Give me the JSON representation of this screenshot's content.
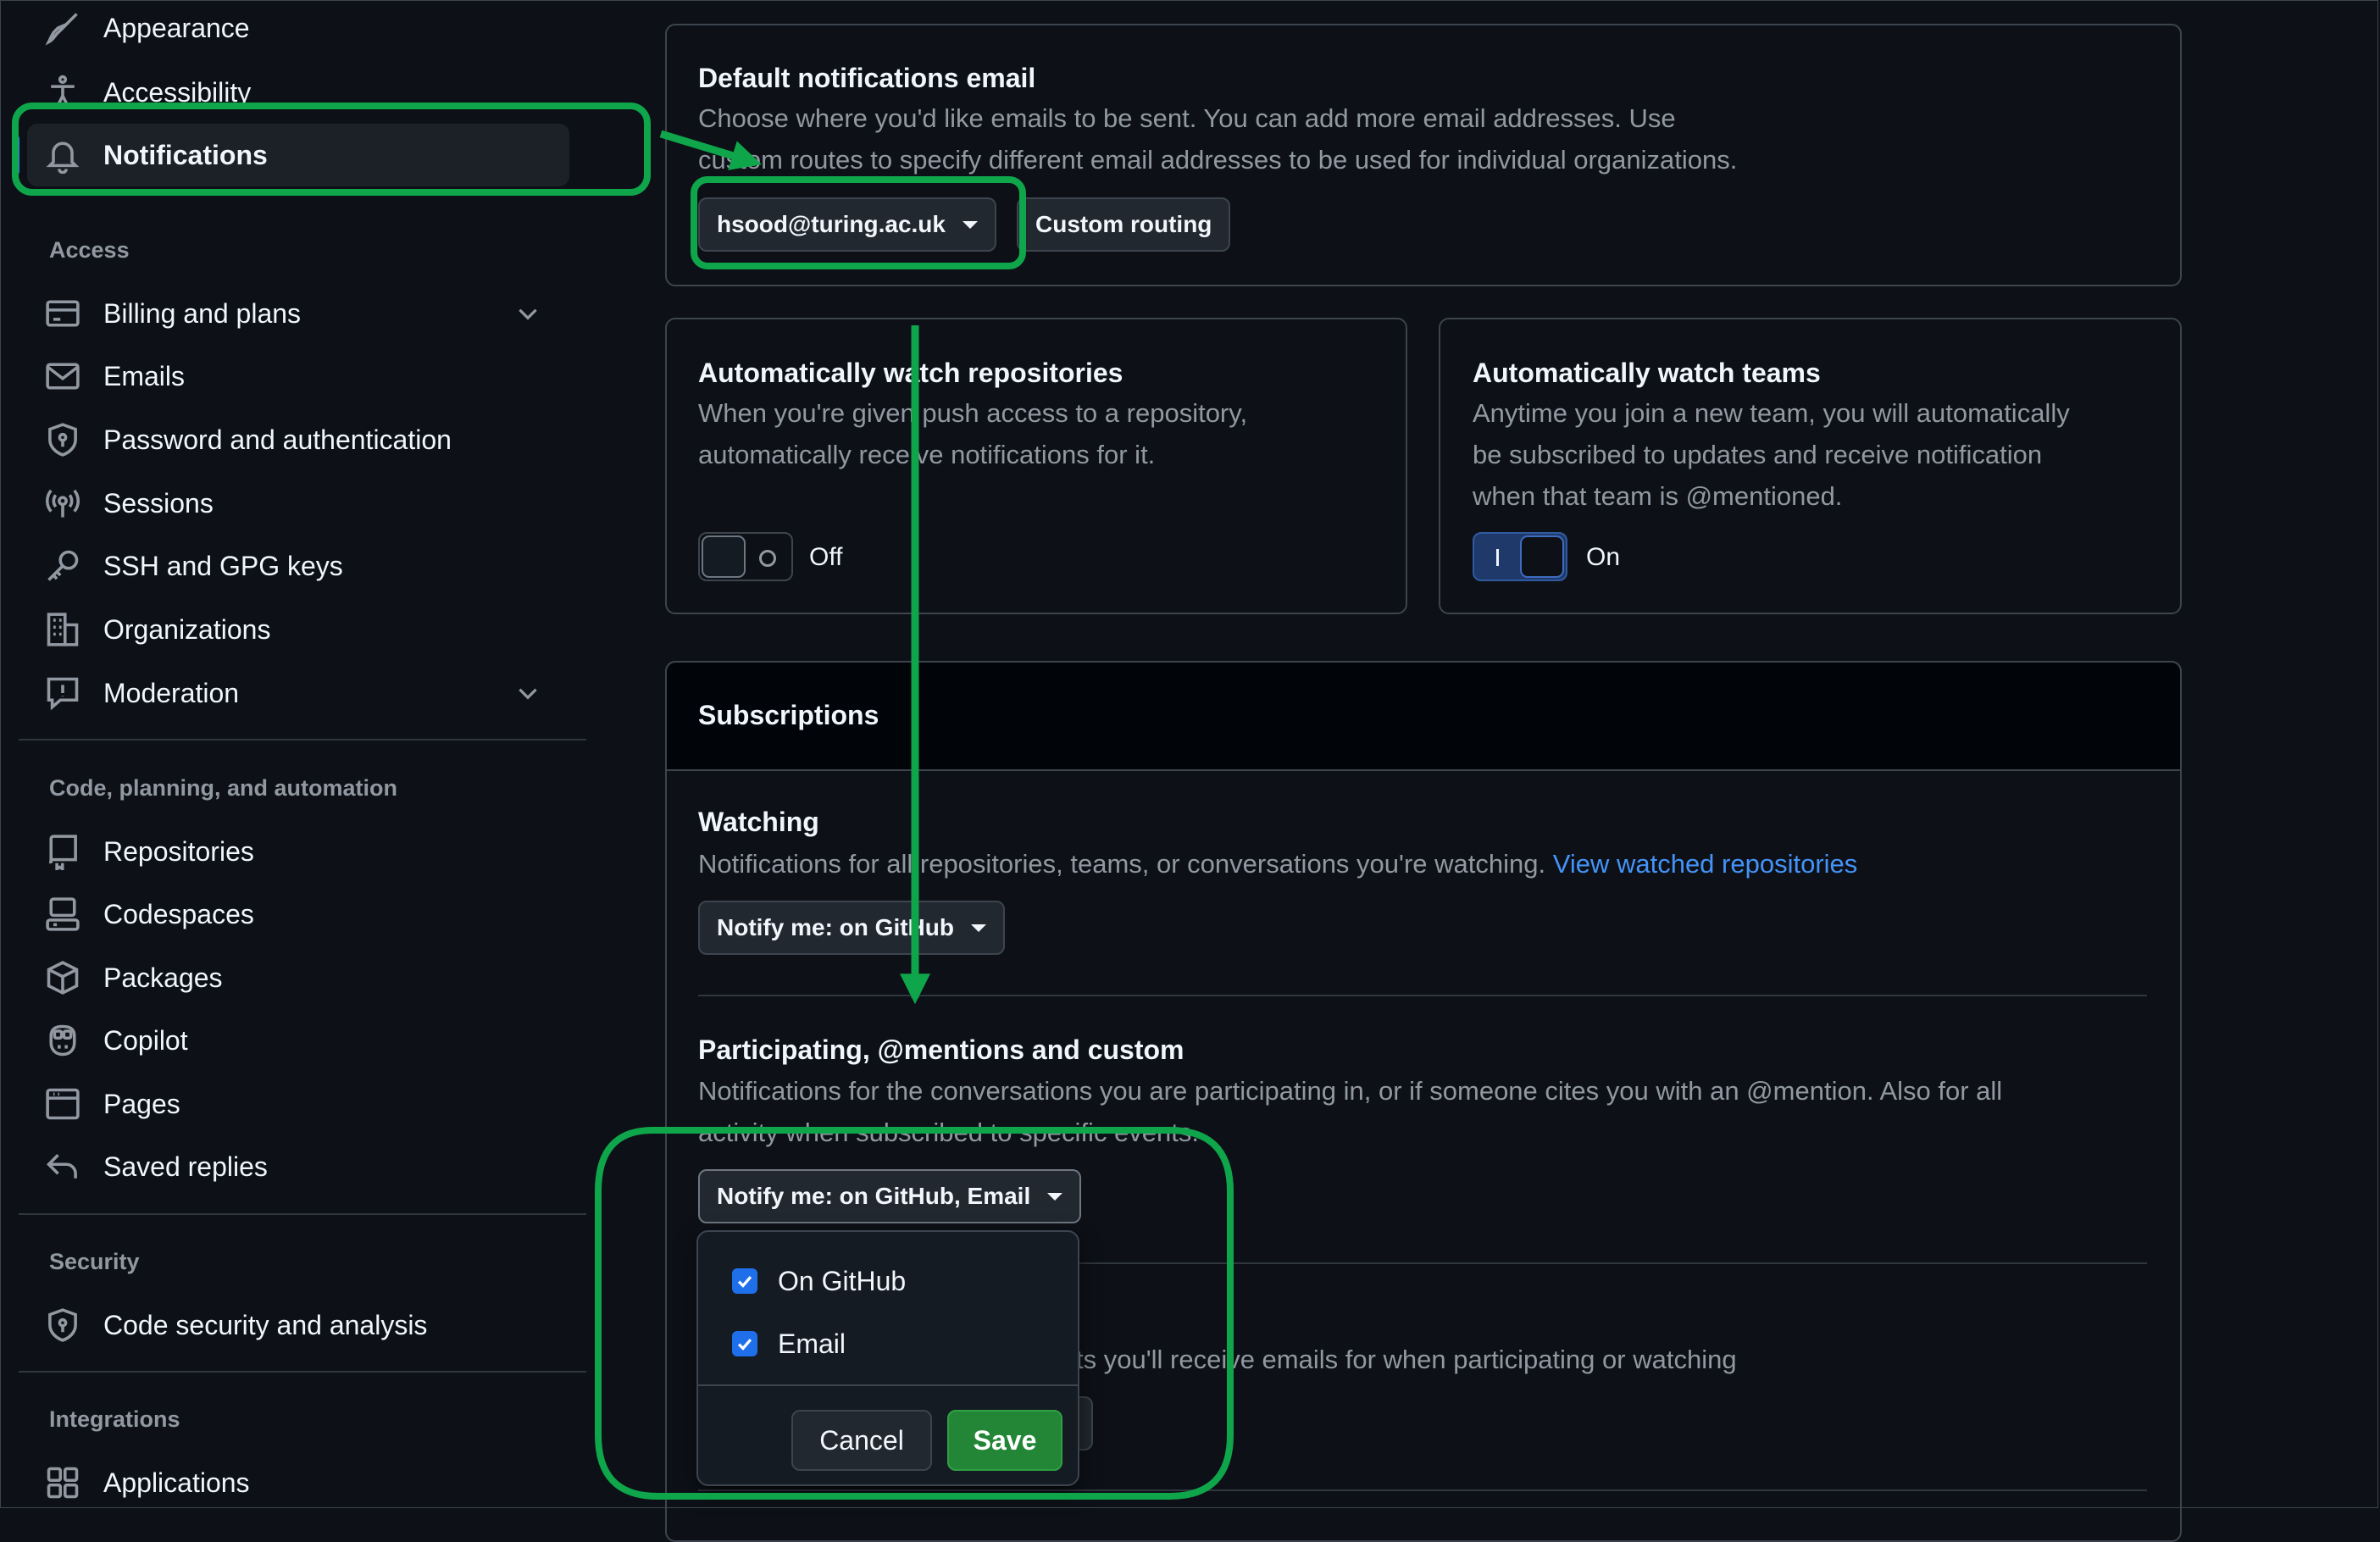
{
  "sidebar": {
    "items": [
      {
        "label": "Appearance"
      },
      {
        "label": "Accessibility"
      },
      {
        "label": "Notifications"
      },
      {
        "label": "Billing and plans"
      },
      {
        "label": "Emails"
      },
      {
        "label": "Password and authentication"
      },
      {
        "label": "Sessions"
      },
      {
        "label": "SSH and GPG keys"
      },
      {
        "label": "Organizations"
      },
      {
        "label": "Moderation"
      },
      {
        "label": "Repositories"
      },
      {
        "label": "Codespaces"
      },
      {
        "label": "Packages"
      },
      {
        "label": "Copilot"
      },
      {
        "label": "Pages"
      },
      {
        "label": "Saved replies"
      },
      {
        "label": "Code security and analysis"
      },
      {
        "label": "Applications"
      }
    ],
    "sections": {
      "access": "Access",
      "code": "Code, planning, and automation",
      "security": "Security",
      "integrations": "Integrations"
    }
  },
  "default_email": {
    "title": "Default notifications email",
    "desc_line1": "Choose where you'd like emails to be sent. You can add more email addresses. Use",
    "desc_line2": "custom routes to specify different email addresses to be used for individual organizations.",
    "email_value": "hsood@turing.ac.uk",
    "custom_routing_label": "Custom routing"
  },
  "watch_repos": {
    "title": "Automatically watch repositories",
    "desc_line1": "When you're given push access to a repository,",
    "desc_line2": "automatically receive notifications for it.",
    "state": "Off"
  },
  "watch_teams": {
    "title": "Automatically watch teams",
    "desc_line1": "Anytime you join a new team, you will automatically",
    "desc_line2": "be subscribed to updates and receive notification",
    "desc_line3": "when that team is @mentioned.",
    "state": "On"
  },
  "subscriptions": {
    "header": "Subscriptions",
    "watching": {
      "title": "Watching",
      "desc": "Notifications for all repositories, teams, or conversations you're watching.",
      "link": "View watched repositories",
      "select": "Notify me: on GitHub"
    },
    "participating": {
      "title": "Participating, @mentions and custom",
      "desc_line1": "Notifications for the conversations you are participating in, or if someone cites you with an @mention. Also for all",
      "desc_line2": "activity when subscribed to specific events.",
      "select": "Notify me: on GitHub, Email"
    },
    "partial_desc": "ts you'll receive emails for when participating or watching"
  },
  "menu": {
    "options": [
      {
        "label": "On GitHub",
        "checked": true
      },
      {
        "label": "Email",
        "checked": true
      }
    ],
    "cancel": "Cancel",
    "save": "Save"
  },
  "colors": {
    "background": "#0d1117",
    "accent_blue": "#1f6feb",
    "link": "#4493f8",
    "save_green": "#238636",
    "annotation_green": "#0fa54b"
  }
}
